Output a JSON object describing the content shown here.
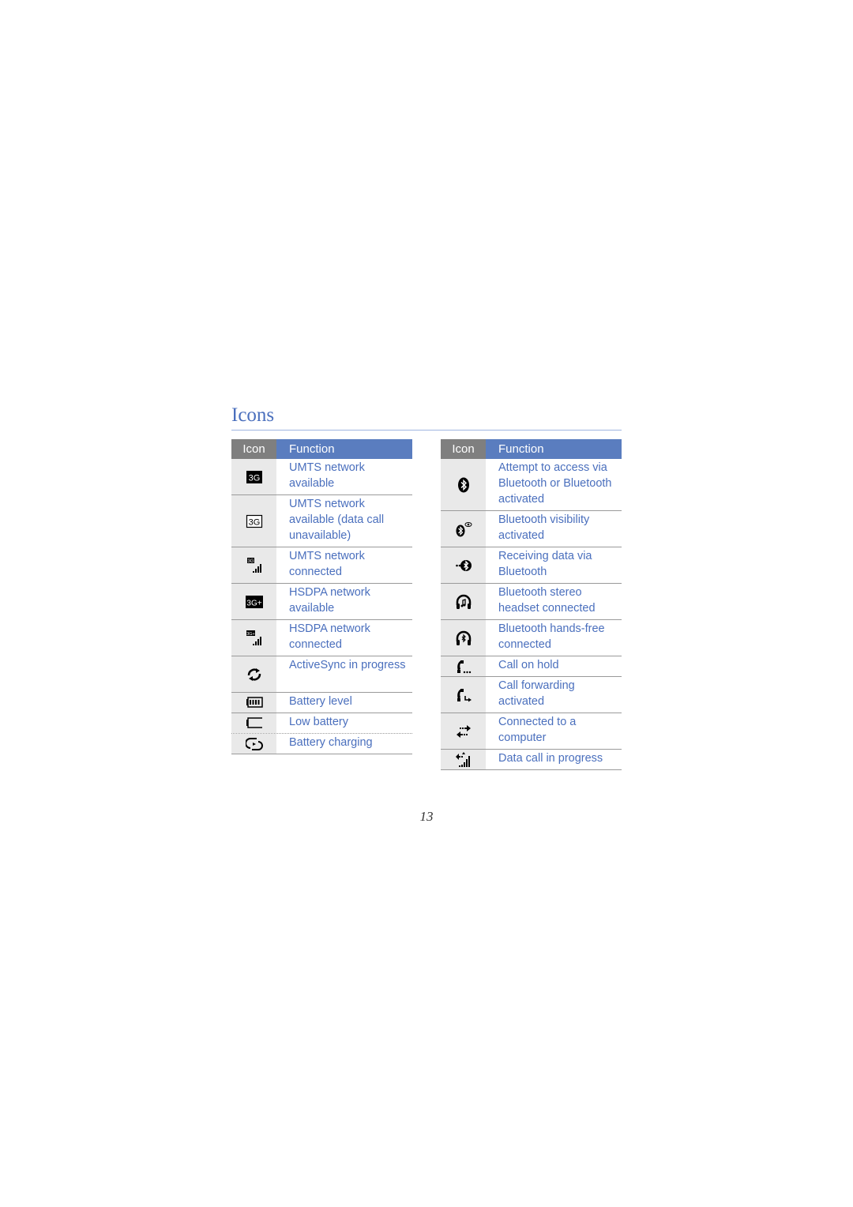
{
  "page": {
    "title": "Icons",
    "page_number": "13"
  },
  "colors": {
    "accent_text": "#4a6fbd",
    "header_icon_bg": "#7f7f7f",
    "header_function_bg": "#5a7dbf",
    "icon_cell_bg": "#e9e9e9"
  },
  "left_table": {
    "header": {
      "icon": "Icon",
      "function": "Function"
    },
    "rows": [
      {
        "icon": "3g-available-icon",
        "function": "UMTS network available"
      },
      {
        "icon": "3g-outline-icon",
        "function": "UMTS network available (data call unavailable)"
      },
      {
        "icon": "3g-connected-icon",
        "function": "UMTS network connected"
      },
      {
        "icon": "3g-plus-icon",
        "function": "HSDPA network available"
      },
      {
        "icon": "3g-plus-connected-icon",
        "function": "HSDPA network connected"
      },
      {
        "icon": "activesync-icon",
        "function": "ActiveSync in progress"
      },
      {
        "icon": "battery-full-icon",
        "function": "Battery level"
      },
      {
        "icon": "battery-low-icon",
        "function": "Low battery"
      },
      {
        "icon": "battery-charging-icon",
        "function": "Battery charging"
      }
    ]
  },
  "right_table": {
    "header": {
      "icon": "Icon",
      "function": "Function"
    },
    "rows": [
      {
        "icon": "bluetooth-icon",
        "function": "Attempt to access via Bluetooth or Bluetooth activated"
      },
      {
        "icon": "bluetooth-visibility-icon",
        "function": "Bluetooth visibility activated"
      },
      {
        "icon": "bluetooth-receiving-icon",
        "function": "Receiving data via Bluetooth"
      },
      {
        "icon": "bluetooth-stereo-headset-icon",
        "function": "Bluetooth stereo headset connected"
      },
      {
        "icon": "bluetooth-handsfree-icon",
        "function": "Bluetooth hands-free connected"
      },
      {
        "icon": "call-on-hold-icon",
        "function": "Call on hold"
      },
      {
        "icon": "call-forwarding-icon",
        "function": "Call forwarding activated"
      },
      {
        "icon": "computer-connected-icon",
        "function": "Connected to a computer"
      },
      {
        "icon": "data-call-icon",
        "function": "Data call in progress"
      }
    ]
  }
}
